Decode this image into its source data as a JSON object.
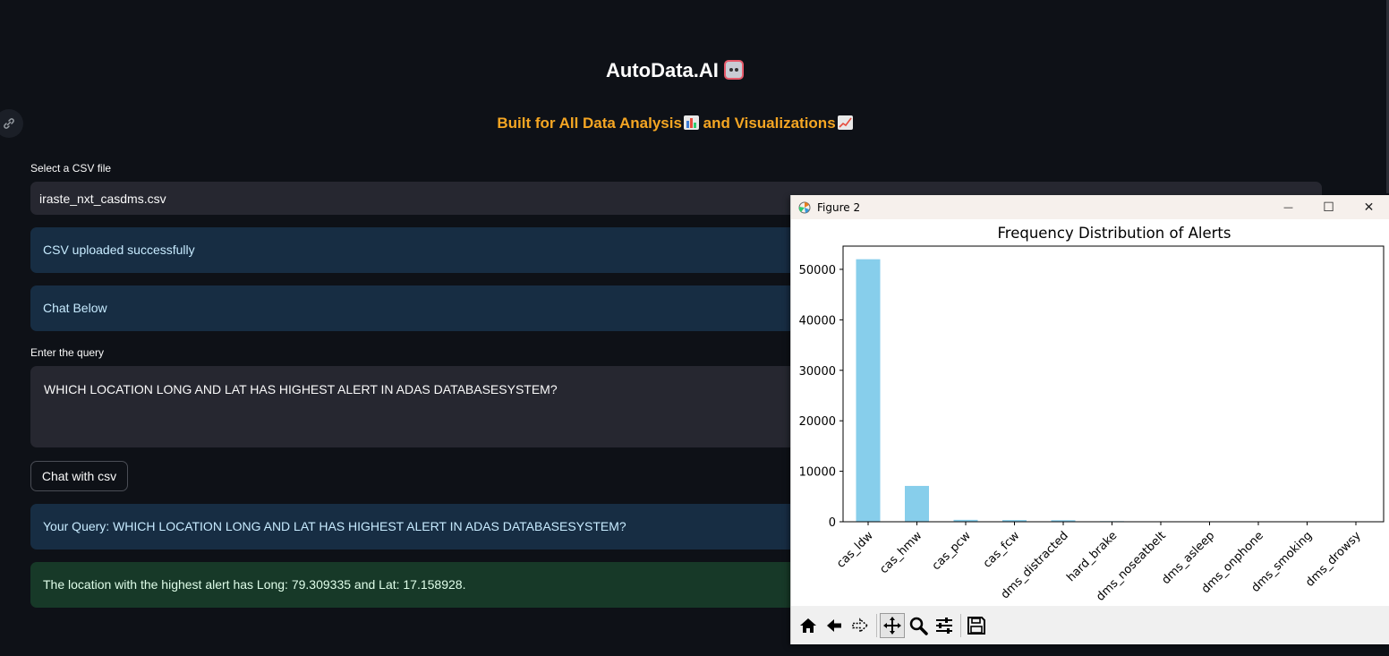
{
  "app": {
    "title": "AutoData.AI",
    "subtitle_part1": "Built for All Data Analysis",
    "subtitle_part2": " and Visualizations"
  },
  "file_upload": {
    "label": "Select a CSV file",
    "selected_file": "iraste_nxt_casdms.csv"
  },
  "alerts": {
    "upload_status": "CSV uploaded successfully",
    "chat_prompt": "Chat Below",
    "your_query": "Your Query: WHICH LOCATION LONG AND LAT HAS HIGHEST ALERT IN ADAS DATABASESYSTEM?",
    "answer": "The location with the highest alert has Long: 79.309335 and Lat: 17.158928."
  },
  "query": {
    "label": "Enter the query",
    "value": "WHICH LOCATION LONG AND LAT HAS HIGHEST ALERT IN ADAS DATABASESYSTEM?"
  },
  "chat_button": "Chat with csv",
  "figure_window": {
    "title": "Figure 2",
    "minimize": "—",
    "maximize": "☐",
    "close": "✕"
  },
  "icons": {
    "link": "link-icon",
    "robot": "robot-emoji",
    "bar_chart": "bar-chart-emoji",
    "trend": "chart-increasing-emoji",
    "toolbar": [
      "home-icon",
      "back-icon",
      "forward-icon",
      "pan-icon",
      "zoom-icon",
      "configure-subplots-icon",
      "save-icon"
    ]
  },
  "colors": {
    "background": "#0e1117",
    "accent_orange": "#f5a623",
    "info_bg": "#172d43",
    "success_bg": "#173928",
    "bar": "#87ceeb"
  },
  "chart_data": {
    "type": "bar",
    "title": "Frequency Distribution of Alerts",
    "xlabel": "",
    "ylabel": "",
    "categories": [
      "cas_ldw",
      "cas_hmw",
      "cas_pcw",
      "cas_fcw",
      "dms_distracted",
      "hard_brake",
      "dms_noseatbelt",
      "dms_asleep",
      "dms_onphone",
      "dms_smoking",
      "dms_drowsy"
    ],
    "values": [
      52000,
      7100,
      380,
      340,
      310,
      120,
      40,
      30,
      20,
      15,
      10
    ],
    "yticks": [
      "0",
      "10000",
      "20000",
      "30000",
      "40000",
      "50000"
    ],
    "ylim": [
      0,
      54600
    ],
    "grid": false,
    "legend": "none"
  }
}
